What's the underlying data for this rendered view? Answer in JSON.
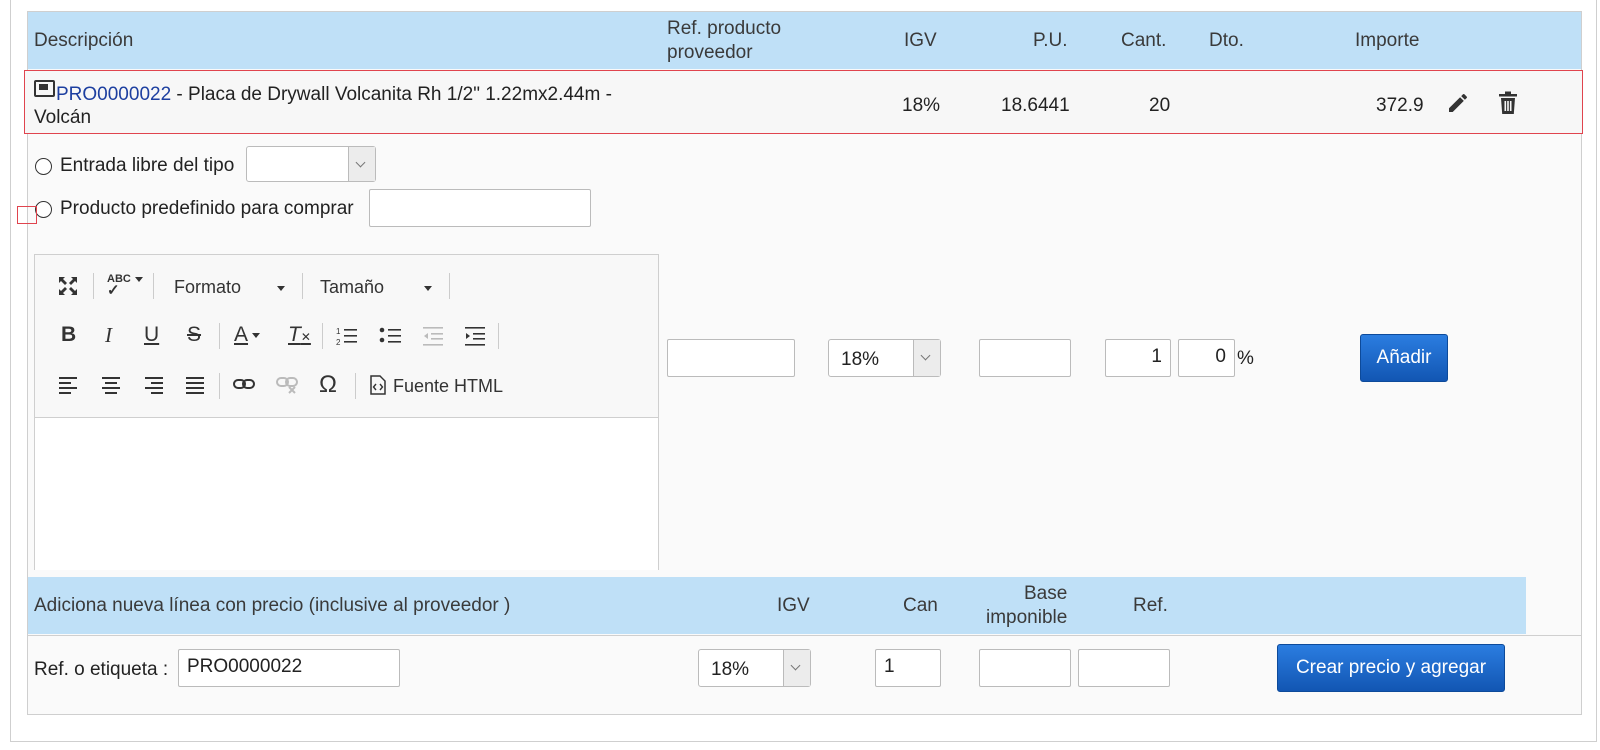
{
  "header": {
    "descripcion": "Descripción",
    "ref_producto_l1": "Ref. producto",
    "ref_producto_l2": "proveedor",
    "igv": "IGV",
    "pu": "P.U.",
    "cant": "Cant.",
    "dto": "Dto.",
    "importe": "Importe"
  },
  "line": {
    "product_ref": "PRO0000022",
    "description_l1": " - Placa de Drywall Volcanita Rh 1/2\" 1.22mx2.44m -",
    "description_l2": "Volcán",
    "igv": "18%",
    "pu": "18.6441",
    "qty": "20",
    "importe": "372.9",
    "icons": [
      "product-icon",
      "pencil-icon",
      "trash-icon"
    ]
  },
  "form": {
    "free_entry_label": "Entrada libre del tipo",
    "free_entry_type": "",
    "predefined_label": "Producto predefinido para comprar",
    "predefined_value": "",
    "editor": {
      "format_label": "Formato",
      "size_label": "Tamaño",
      "source_label": "Fuente HTML"
    },
    "ref_value": "",
    "igv_value": "18%",
    "pu_value": "",
    "qty_value": "1",
    "discount_value": "0",
    "percent_sign": "%",
    "add_button": "Añadir"
  },
  "price_header": {
    "title": "Adiciona nueva línea con precio (inclusive al proveedor )",
    "igv": "IGV",
    "can": "Can",
    "base_l1": "Base",
    "base_l2": "imponible",
    "ref": "Ref."
  },
  "price_row": {
    "ref_label": "Ref. o etiqueta :",
    "ref_value": "PRO0000022",
    "igv_value": "18%",
    "qty_value": "1",
    "base_value": "",
    "ref2_value": "",
    "create_button": "Crear precio y agregar"
  },
  "colors": {
    "header_bg": "#bfe0f7",
    "button_blue": "#1565c0",
    "highlight_red": "#e0444e",
    "link_blue": "#1d3fa0"
  }
}
